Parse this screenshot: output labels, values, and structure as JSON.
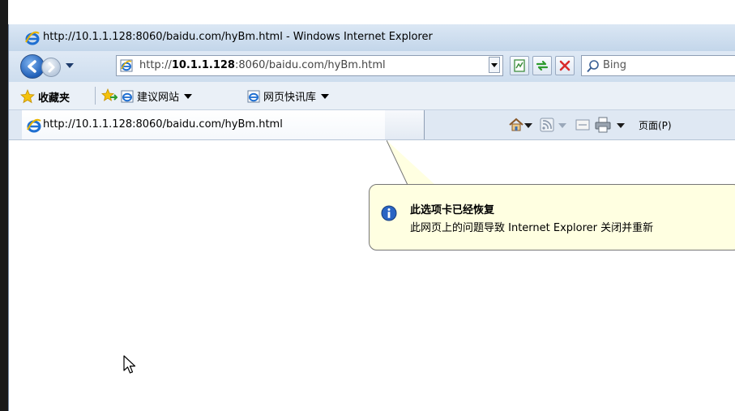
{
  "window": {
    "title": "http://10.1.1.128:8060/baidu.com/hyBm.html - Windows Internet Explorer"
  },
  "navbar": {
    "address_prefix": "http://",
    "address_host": "10.1.1.128",
    "address_rest": ":8060/baidu.com/hyBm.html",
    "search_placeholder": "Bing"
  },
  "favorites": {
    "label": "收藏夹",
    "links": [
      "建议网站 ▾",
      "网页快讯库 ▾"
    ],
    "link1": "建议网站",
    "link2": "网页快讯库"
  },
  "tabs": {
    "active_label": "http://10.1.1.128:8060/baidu.com/hyBm.html"
  },
  "command_bar": {
    "page_label": "页面(P)"
  },
  "notification": {
    "title": "此选项卡已经恢复",
    "message": "此网页上的问题导致 Internet Explorer 关闭并重新"
  },
  "colors": {
    "balloon_bg": "#ffffe1",
    "titlebar": "#c3d6ea",
    "ie_blue": "#1f6fd1"
  }
}
